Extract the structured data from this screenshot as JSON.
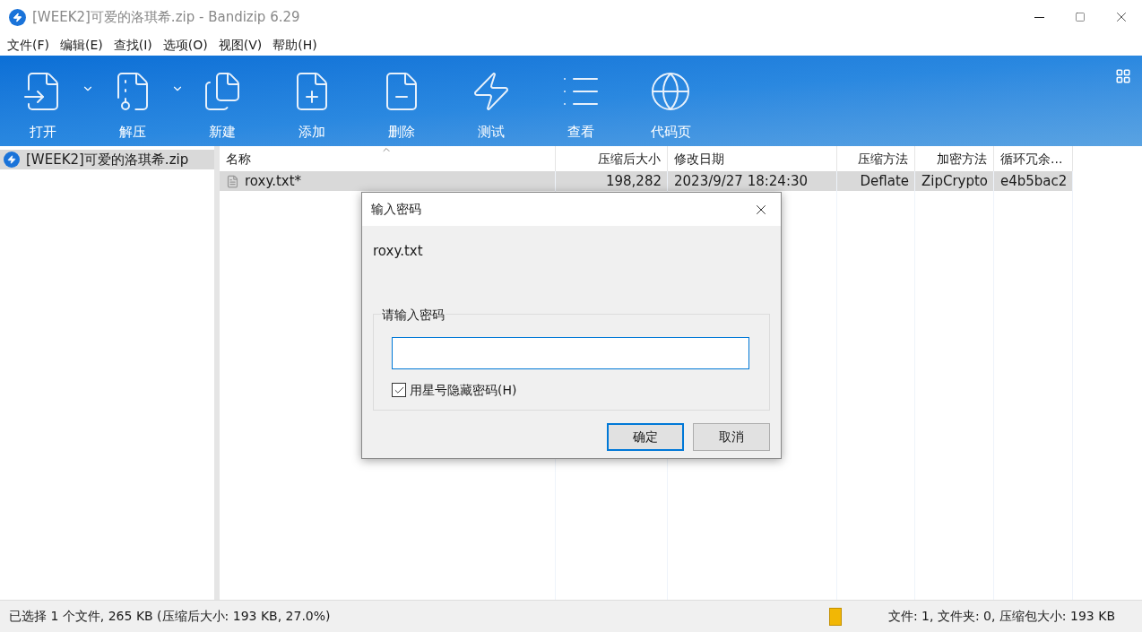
{
  "window": {
    "title": "[WEEK2]可爱的洛琪希.zip - Bandizip 6.29"
  },
  "menu": [
    "文件(F)",
    "编辑(E)",
    "查找(I)",
    "选项(O)",
    "视图(V)",
    "帮助(H)"
  ],
  "toolbar": [
    {
      "kind": "open",
      "label": "打开",
      "dropdown": true
    },
    {
      "kind": "extract",
      "label": "解压",
      "dropdown": true
    },
    {
      "kind": "new",
      "label": "新建",
      "dropdown": false
    },
    {
      "kind": "add",
      "label": "添加",
      "dropdown": false
    },
    {
      "kind": "delete",
      "label": "删除",
      "dropdown": false
    },
    {
      "kind": "test",
      "label": "测试",
      "dropdown": false
    },
    {
      "kind": "view",
      "label": "查看",
      "dropdown": false
    },
    {
      "kind": "codepage",
      "label": "代码页",
      "dropdown": false
    }
  ],
  "sidebar": {
    "items": [
      {
        "label": "[WEEK2]可爱的洛琪希.zip",
        "selected": true
      }
    ]
  },
  "table": {
    "columns": [
      {
        "label": "名称"
      },
      {
        "label": "压缩后大小"
      },
      {
        "label": "修改日期"
      },
      {
        "label": "压缩方法"
      },
      {
        "label": "加密方法"
      },
      {
        "label": "循环冗余..."
      }
    ],
    "rows": [
      {
        "selected": true,
        "cells": [
          "roxy.txt*",
          "198,282",
          "2023/9/27 18:24:30",
          "Deflate",
          "ZipCrypto",
          "e4b5bac2"
        ]
      }
    ]
  },
  "dialog": {
    "title": "输入密码",
    "file": "roxy.txt",
    "group_label": "请输入密码",
    "hide_checkbox": {
      "label": "用星号隐藏密码(H)",
      "checked": true
    },
    "buttons": [
      {
        "label": "确定",
        "default": true
      },
      {
        "label": "取消",
        "default": false
      }
    ]
  },
  "status_bar": {
    "left": "已选择 1 个文件, 265 KB (压缩后大小: 193 KB, 27.0%)",
    "right": "文件: 1, 文件夹: 0, 压缩包大小: 193 KB"
  }
}
